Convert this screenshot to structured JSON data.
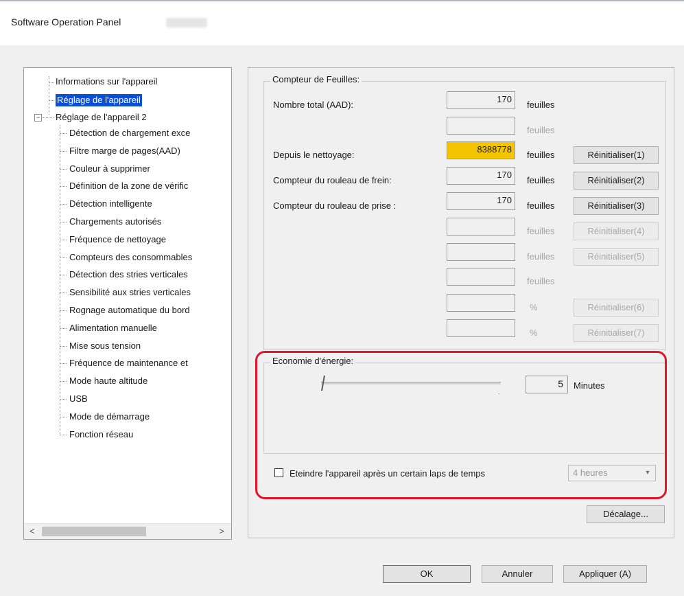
{
  "window": {
    "title": "Software Operation Panel"
  },
  "tree": {
    "root_items": [
      {
        "label": "Informations sur l'appareil"
      },
      {
        "label": "Réglage de l'appareil",
        "selected": true
      },
      {
        "label": "Réglage de l'appareil 2",
        "expanded": true
      }
    ],
    "expander_glyph": "−",
    "children": [
      "Détection de chargement exce",
      "Filtre marge de pages(AAD)",
      "Couleur à supprimer",
      "Définition de la zone de vérific",
      "Détection intelligente",
      "Chargements autorisés",
      "Fréquence de nettoyage",
      "Compteurs des consommables",
      "Détection des stries verticales",
      "Sensibilité aux stries verticales",
      "Rognage automatique du bord",
      "Alimentation manuelle",
      "Mise sous tension",
      "Fréquence de maintenance et",
      "Mode haute altitude",
      "USB",
      "Mode de démarrage",
      "Fonction réseau"
    ],
    "scroll_left": "<",
    "scroll_right": ">"
  },
  "counters": {
    "group_title": "Compteur de Feuilles:",
    "rows": [
      {
        "label": "Nombre total (AAD):",
        "value": "170",
        "unit": "feuilles",
        "unit_disabled": false,
        "reset": ""
      },
      {
        "label": "",
        "value": "",
        "unit": "feuilles",
        "unit_disabled": true,
        "reset": ""
      },
      {
        "label": "Depuis le nettoyage:",
        "value": "8388778",
        "unit": "feuilles",
        "unit_disabled": false,
        "reset": "Réinitialiser(1)",
        "reset_disabled": false,
        "highlight": true
      },
      {
        "label": "Compteur du rouleau de frein:",
        "value": "170",
        "unit": "feuilles",
        "unit_disabled": false,
        "reset": "Réinitialiser(2)",
        "reset_disabled": false
      },
      {
        "label": "Compteur du rouleau de prise :",
        "value": "170",
        "unit": "feuilles",
        "unit_disabled": false,
        "reset": "Réinitialiser(3)",
        "reset_disabled": false
      },
      {
        "label": "",
        "value": "",
        "unit": "feuilles",
        "unit_disabled": true,
        "reset": "Réinitialiser(4)",
        "reset_disabled": true
      },
      {
        "label": "",
        "value": "",
        "unit": "feuilles",
        "unit_disabled": true,
        "reset": "Réinitialiser(5)",
        "reset_disabled": true
      },
      {
        "label": "",
        "value": "",
        "unit": "feuilles",
        "unit_disabled": true,
        "reset": ""
      },
      {
        "label": "",
        "value": "",
        "unit": "%",
        "unit_disabled": true,
        "reset": "Réinitialiser(6)",
        "reset_disabled": true
      },
      {
        "label": "",
        "value": "",
        "unit": "%",
        "unit_disabled": true,
        "reset": "Réinitialiser(7)",
        "reset_disabled": true
      }
    ]
  },
  "energy": {
    "group_title": "Economie d'énergie:",
    "minutes_value": "5",
    "minutes_unit": "Minutes",
    "slider_level_percent": 0,
    "auto_off_label": "Eteindre l'appareil après un certain laps de temps",
    "auto_off_checked": false,
    "auto_off_selected": "4 heures",
    "dropdown_glyph": "▾"
  },
  "buttons": {
    "offset": "Décalage...",
    "ok": "OK",
    "cancel": "Annuler",
    "apply": "Appliquer (A)"
  },
  "colors": {
    "selection": "#0a4fd6",
    "highlight_counter": "#f5c400",
    "annotation_red": "#e3152a"
  }
}
